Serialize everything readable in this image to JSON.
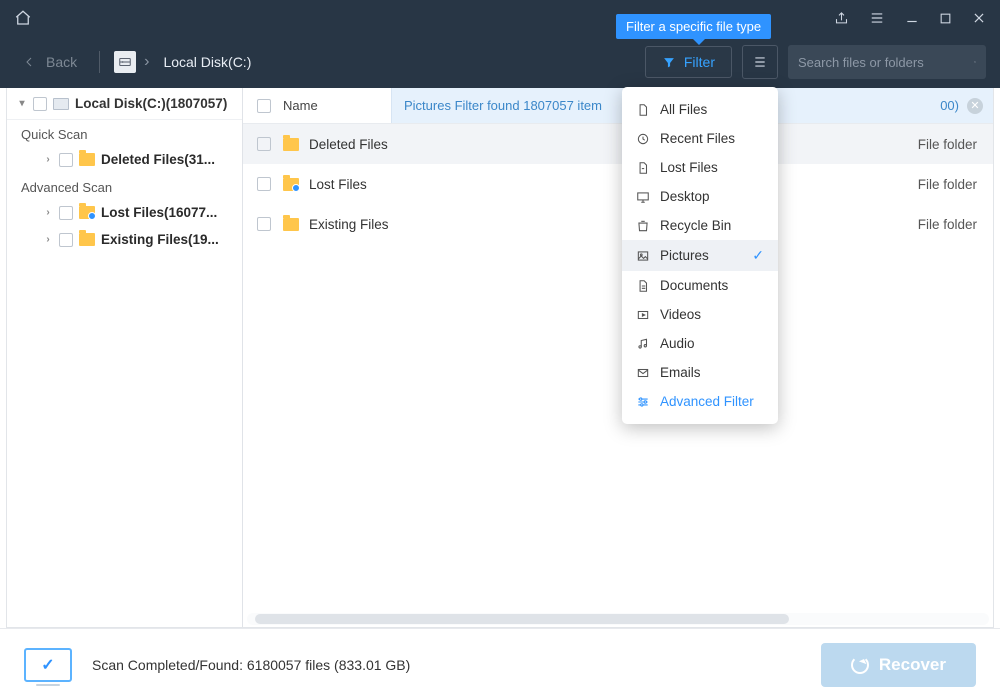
{
  "tooltip": "Filter a specific file type",
  "back_label": "Back",
  "breadcrumb": "Local Disk(C:)",
  "filter_label": "Filter",
  "search_placeholder": "Search files or folders",
  "sidebar": {
    "root": "Local Disk(C:)(1807057)",
    "sections": [
      {
        "label": "Quick Scan",
        "items": [
          "Deleted Files(31..."
        ]
      },
      {
        "label": "Advanced Scan",
        "items": [
          "Lost Files(16077...",
          "Existing Files(19..."
        ]
      }
    ]
  },
  "header_name": "Name",
  "notice_text": "Pictures Filter found 1807057 item",
  "notice_tail": "00)",
  "rows": [
    {
      "name": "Deleted Files",
      "type": "File folder",
      "sel": true,
      "dot": false
    },
    {
      "name": "Lost Files",
      "type": "File folder",
      "sel": false,
      "dot": true
    },
    {
      "name": "Existing Files",
      "type": "File folder",
      "sel": false,
      "dot": false
    }
  ],
  "filter_menu": {
    "items": [
      "All Files",
      "Recent Files",
      "Lost Files",
      "Desktop",
      "Recycle Bin",
      "Pictures",
      "Documents",
      "Videos",
      "Audio",
      "Emails"
    ],
    "selected": "Pictures",
    "advanced": "Advanced Filter"
  },
  "status": "Scan Completed/Found: 6180057 files (833.01 GB)",
  "recover_label": "Recover"
}
